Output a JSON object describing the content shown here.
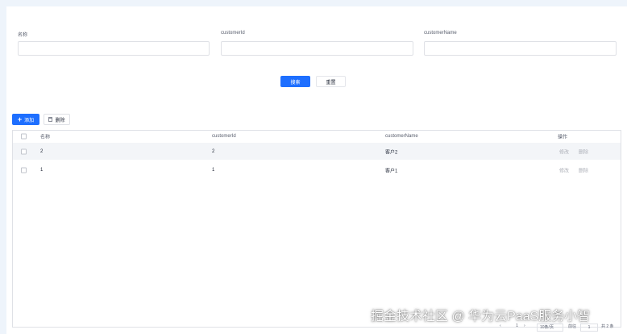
{
  "search": {
    "fields": [
      {
        "label": "名称",
        "value": ""
      },
      {
        "label": "customerId",
        "value": ""
      },
      {
        "label": "customerName",
        "value": ""
      }
    ],
    "search_label": "搜索",
    "reset_label": "重置"
  },
  "toolbar": {
    "add_label": "添加",
    "delete_label": "删除",
    "add_icon": "plus-icon",
    "delete_icon": "trash-icon"
  },
  "table": {
    "columns": [
      "名称",
      "customerId",
      "customerName",
      "操作"
    ],
    "rows": [
      {
        "name": "2",
        "customerId": "2",
        "customerName": "客户2",
        "edit": "修改",
        "delete": "删除"
      },
      {
        "name": "1",
        "customerId": "1",
        "customerName": "客户1",
        "edit": "修改",
        "delete": "删除"
      }
    ]
  },
  "pagination": {
    "prev": "‹",
    "page": "1",
    "next": "›",
    "page_size": "10条/页",
    "jump_label": "前往",
    "jump_value": "1",
    "total": "共 2 条"
  },
  "watermark": "掘金技术社区 @ 华为云PaaS服务小智",
  "colors": {
    "primary": "#1e6fff",
    "background": "#eef4fb",
    "row_stripe": "#f3f5f8"
  }
}
